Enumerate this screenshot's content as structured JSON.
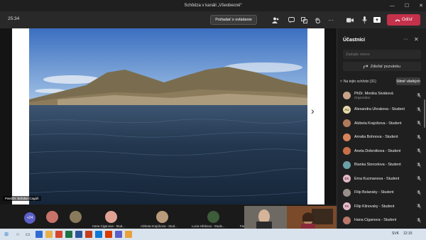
{
  "window": {
    "title": "Schôdza v kanáli „Všeobecné“",
    "minimize": "—",
    "maximize": "☐",
    "close": "✕"
  },
  "toolbar": {
    "timer": "25:34",
    "approve_label": "Požiadať o ovládanie",
    "leave_label": "Odísť"
  },
  "stage": {
    "presenter_tag": "PaedDr. Bohdan Cagáň"
  },
  "panel": {
    "title": "Účastníci",
    "more": "···",
    "close": "✕",
    "invite_placeholder": "Zadajte meno",
    "share_label": "Zdieľať pozvánku",
    "section_label": "Na tejto schôdzi (31)",
    "mute_all_label": "Stlmiť všetkých",
    "participants": [
      {
        "name": "PhDr. Monika Siváková",
        "role": "Organizátor",
        "initials": "",
        "color": "#c9a28a"
      },
      {
        "name": "Alexandra Uhrakova - Student",
        "role": "",
        "initials": "AU",
        "color": "#e8d9a8"
      },
      {
        "name": "Alzbeta Krajcikova - Student",
        "role": "",
        "initials": "",
        "color": "#b07a5a"
      },
      {
        "name": "Amalia Bohnova - Student",
        "role": "",
        "initials": "",
        "color": "#d6845a"
      },
      {
        "name": "Aneta Dobrotkova - Student",
        "role": "",
        "initials": "",
        "color": "#c86f4a"
      },
      {
        "name": "Bianka Storcelova - Student",
        "role": "",
        "initials": "",
        "color": "#6aa0a8"
      },
      {
        "name": "Ema Kucmanova - Student",
        "role": "",
        "initials": "EK",
        "color": "#e6b6c7"
      },
      {
        "name": "Filip Belansky - Student",
        "role": "",
        "initials": "",
        "color": "#9a8e8a"
      },
      {
        "name": "Filip Klinovsky - Student",
        "role": "",
        "initials": "FK",
        "color": "#e6b6c7"
      },
      {
        "name": "Hana Ciganova - Student",
        "role": "",
        "initials": "",
        "color": "#b8776a"
      }
    ]
  },
  "gallery": {
    "more_count": "+24",
    "tiles": [
      {
        "label": "Hana Ciganova - Stud...",
        "color": "#c98a7a"
      },
      {
        "label": "Alzbeta Krajcikova - Stud...",
        "color": "#a88a6a"
      },
      {
        "label": "Lucia Hlinkova - Stude...",
        "color": "#3a5a3a"
      },
      {
        "label": "PaedDr. Bo...",
        "color": "#777"
      }
    ]
  },
  "taskbar": {
    "lang": "SVK",
    "time": "12:15"
  },
  "icons": [
    "close-icon",
    "more-icon",
    "share-icon",
    "mic-muted-icon",
    "chevron-right-icon",
    "chevron-down-icon",
    "people-icon",
    "chat-icon",
    "raise-hand-icon",
    "camera-icon",
    "mic-icon",
    "share-screen-icon",
    "phone-icon",
    "windows-start-icon",
    "search-icon"
  ]
}
